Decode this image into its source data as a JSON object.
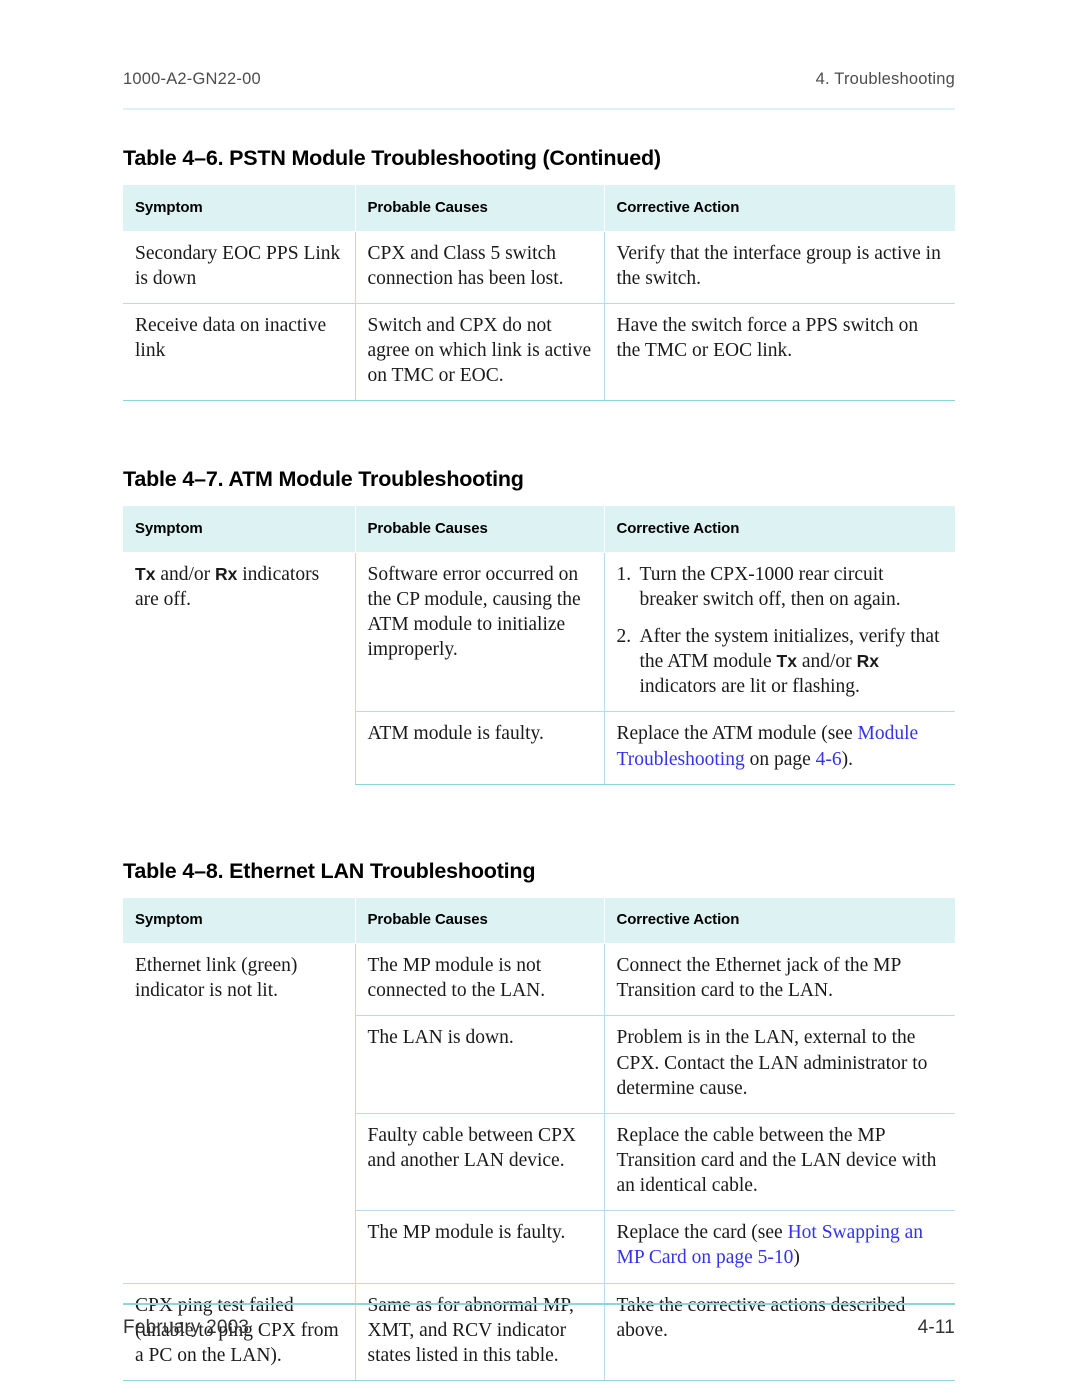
{
  "header": {
    "doc_number": "1000-A2-GN22-00",
    "chapter": "4. Troubleshooting"
  },
  "footer": {
    "date": "February 2003",
    "page_number": "4-11"
  },
  "colors": {
    "header_band": "#ddf2f3",
    "cell_border": "#bcd8ef",
    "table_edge_rule": "#8fd4d8",
    "link": "#3333ee",
    "running_head_rule": "#ddf3f8"
  },
  "columns": [
    "Symptom",
    "Probable Causes",
    "Corrective Action"
  ],
  "tables": [
    {
      "caption": "Table 4–6. PSTN Module Troubleshooting (Continued)",
      "headers": [
        "Symptom",
        "Probable Causes",
        "Corrective Action"
      ],
      "rows": [
        {
          "symptom": "Secondary EOC PPS Link is down",
          "cause": "CPX and Class 5 switch connection has been lost.",
          "action": "Verify that the interface group is active in the switch."
        },
        {
          "symptom": "Receive data on inactive link",
          "cause": "Switch and CPX do not agree on which link is active on TMC or EOC.",
          "action": "Have the switch force a PPS switch on the TMC or EOC link."
        }
      ]
    },
    {
      "caption": "Table 4–7. ATM Module Troubleshooting",
      "headers": [
        "Symptom",
        "Probable Causes",
        "Corrective Action"
      ],
      "rows": [
        {
          "symptom_pre": "",
          "symptom_bold1": "Tx",
          "symptom_mid": " and/or ",
          "symptom_bold2": "Rx",
          "symptom_post": " indicators are off.",
          "cause": "Software error occurred on the CP module, causing the ATM module to initialize improperly.",
          "action_steps": [
            {
              "num": "1.",
              "text": "Turn the CPX-1000 rear circuit breaker switch off, then on again."
            },
            {
              "num": "2.",
              "pre": "After the system initializes, verify that the ATM module ",
              "bold1": "Tx",
              "mid": " and/or ",
              "bold2": "Rx",
              "post": " indicators are lit or flashing."
            }
          ]
        },
        {
          "symptom": "",
          "cause": "ATM module is faulty.",
          "action_pre": "Replace the ATM module (see ",
          "action_link": "Module Troubleshooting",
          "action_mid": " on page ",
          "action_link2": "4-6",
          "action_post": ")."
        }
      ]
    },
    {
      "caption": "Table 4–8. Ethernet LAN Troubleshooting",
      "headers": [
        "Symptom",
        "Probable Causes",
        "Corrective Action"
      ],
      "rows": [
        {
          "symptom": "Ethernet link (green) indicator is not lit.",
          "cause": "The MP module is not connected to the LAN.",
          "action": "Connect the Ethernet jack of the MP Transition card to the LAN."
        },
        {
          "symptom": "",
          "cause": "The LAN is down.",
          "action": "Problem is in the LAN, external to the CPX. Contact the LAN administrator to determine cause."
        },
        {
          "symptom": "",
          "cause": "Faulty cable between CPX and another LAN device.",
          "action": "Replace the cable between the MP Transition card and the LAN device with an identical cable."
        },
        {
          "symptom": "",
          "cause": "The MP module is faulty.",
          "action_pre": "Replace the card (see ",
          "action_link": "Hot Swapping an MP Card on page 5-10",
          "action_post": ")"
        },
        {
          "symptom": "CPX ping test failed (unable to ping CPX from a PC on the LAN).",
          "cause": "Same as for abnormal MP, XMT, and RCV indicator states listed in this table.",
          "action": "Take the corrective actions described above."
        }
      ]
    }
  ]
}
